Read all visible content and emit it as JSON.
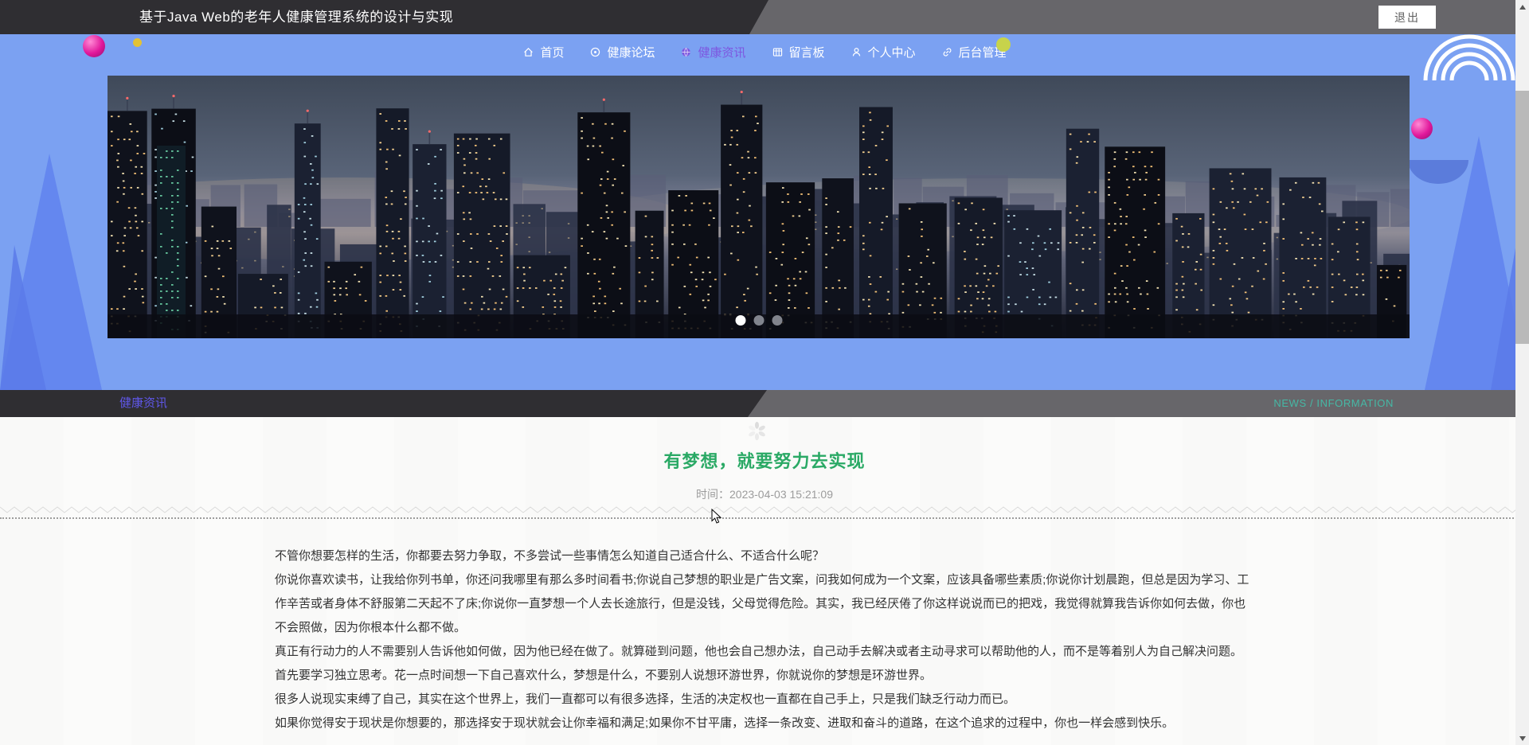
{
  "header": {
    "title": "基于Java Web的老年人健康管理系统的设计与实现",
    "logout_label": "退出"
  },
  "nav": {
    "items": [
      {
        "name": "home",
        "label": "首页",
        "icon": "home-icon",
        "active": false
      },
      {
        "name": "forum",
        "label": "健康论坛",
        "icon": "forum-icon",
        "active": false
      },
      {
        "name": "news",
        "label": "健康资讯",
        "icon": "news-icon",
        "active": true
      },
      {
        "name": "board",
        "label": "留言板",
        "icon": "board-icon",
        "active": false
      },
      {
        "name": "profile",
        "label": "个人中心",
        "icon": "user-icon",
        "active": false
      },
      {
        "name": "admin",
        "label": "后台管理",
        "icon": "link-icon",
        "active": false
      }
    ]
  },
  "carousel": {
    "dots": [
      {
        "active": true
      },
      {
        "active": false
      },
      {
        "active": false
      }
    ]
  },
  "section_banner": {
    "title": "健康资讯",
    "subtitle": "NEWS / INFORMATION"
  },
  "article": {
    "title": "有梦想，就要努力去实现",
    "time": "时间：2023-04-03 15:21:09",
    "paragraphs": [
      "不管你想要怎样的生活，你都要去努力争取，不多尝试一些事情怎么知道自己适合什么、不适合什么呢？",
      "你说你喜欢读书，让我给你列书单，你还问我哪里有那么多时间看书;你说自己梦想的职业是广告文案，问我如何成为一个文案，应该具备哪些素质;你说你计划晨跑，但总是因为学习、工作辛苦或者身体不舒服第二天起不了床;你说你一直梦想一个人去长途旅行，但是没钱，父母觉得危险。其实，我已经厌倦了你这样说说而已的把戏，我觉得就算我告诉你如何去做，你也不会照做，因为你根本什么都不做。",
      "真正有行动力的人不需要别人告诉他如何做，因为他已经在做了。就算碰到问题，他也会自己想办法，自己动手去解决或者主动寻求可以帮助他的人，而不是等着别人为自己解决问题。",
      "首先要学习独立思考。花一点时间想一下自己喜欢什么，梦想是什么，不要别人说想环游世界，你就说你的梦想是环游世界。",
      "很多人说现实束缚了自己，其实在这个世界上，我们一直都可以有很多选择，生活的决定权也一直都在自己手上，只是我们缺乏行动力而已。",
      "如果你觉得安于现状是你想要的，那选择安于现状就会让你幸福和满足;如果你不甘平庸，选择一条改变、进取和奋斗的道路，在这个追求的过程中，你也一样会感到快乐。"
    ]
  },
  "colors": {
    "topbar_dark": "#2f2e32",
    "topbar_gray": "#67666a",
    "blue_bg": "#7ba1f2",
    "nav_active": "#7d57e0",
    "banner_title": "#5f57e8",
    "banner_subtitle": "#46b8a5",
    "article_title": "#2aa965"
  }
}
